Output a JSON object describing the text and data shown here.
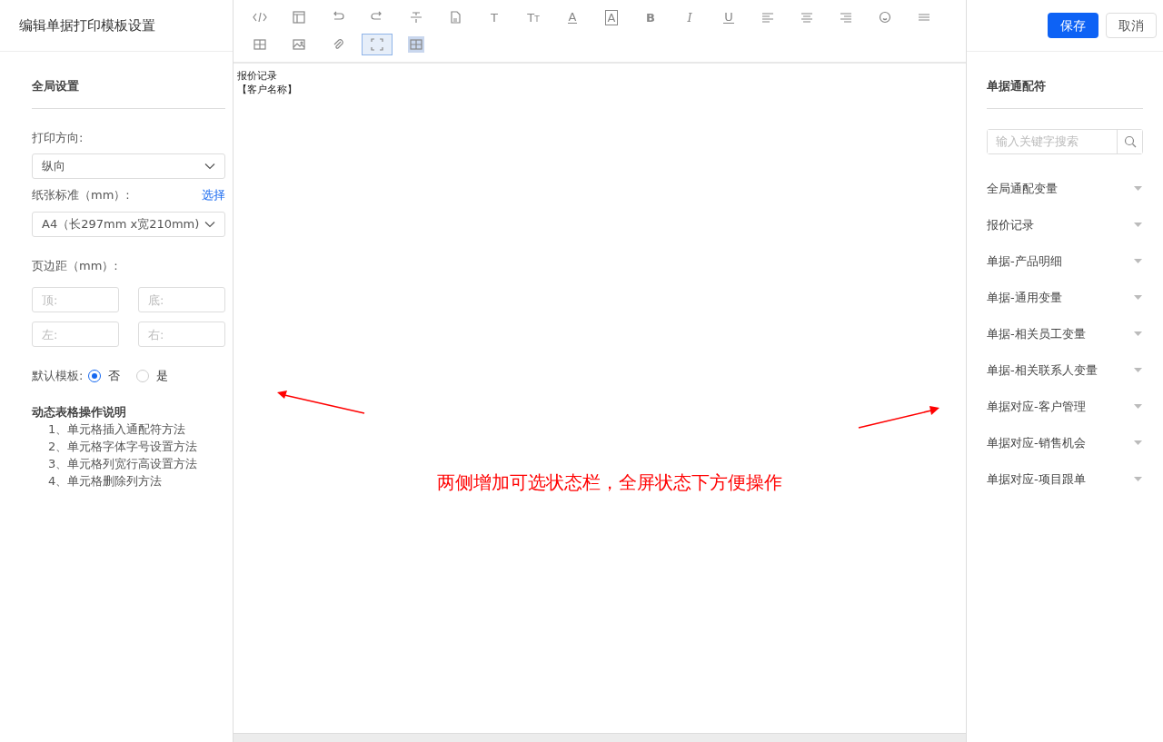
{
  "title": "编辑单据打印模板设置",
  "buttons": {
    "save": "保存",
    "cancel": "取消"
  },
  "toolbar": [
    {
      "kind": "code",
      "selected": false,
      "highlighted": false
    },
    {
      "kind": "layout",
      "selected": false,
      "highlighted": false
    },
    {
      "kind": "undo",
      "selected": false,
      "highlighted": false
    },
    {
      "kind": "redo",
      "selected": false,
      "highlighted": false
    },
    {
      "kind": "strike",
      "selected": false,
      "highlighted": false
    },
    {
      "kind": "file",
      "selected": false,
      "highlighted": false
    },
    {
      "kind": "letter",
      "glyph": "T",
      "selected": false,
      "highlighted": false
    },
    {
      "kind": "letter-small",
      "glyph": "TT",
      "selected": false,
      "highlighted": false
    },
    {
      "kind": "letter-underline",
      "glyph": "A",
      "selected": false,
      "highlighted": false
    },
    {
      "kind": "letter-boxed",
      "glyph": "A",
      "selected": false,
      "highlighted": false
    },
    {
      "kind": "letter-bold",
      "glyph": "B",
      "selected": false,
      "highlighted": false
    },
    {
      "kind": "letter-italic",
      "glyph": "I",
      "selected": false,
      "highlighted": false
    },
    {
      "kind": "letter-underline",
      "glyph": "U",
      "selected": false,
      "highlighted": false
    },
    {
      "kind": "align-left",
      "selected": false,
      "highlighted": false
    },
    {
      "kind": "align-center",
      "selected": false,
      "highlighted": false
    },
    {
      "kind": "align-right",
      "selected": false,
      "highlighted": false
    },
    {
      "kind": "emoji",
      "selected": false,
      "highlighted": false
    },
    {
      "kind": "lines",
      "selected": false,
      "highlighted": false
    },
    {
      "kind": "table",
      "selected": false,
      "highlighted": false
    },
    {
      "kind": "image",
      "selected": false,
      "highlighted": false
    },
    {
      "kind": "attach",
      "selected": false,
      "highlighted": false
    },
    {
      "kind": "fullscreen",
      "selected": true,
      "highlighted": false
    },
    {
      "kind": "table",
      "selected": false,
      "highlighted": true
    }
  ],
  "editor": {
    "lines": [
      "报价记录",
      "【客户名称】"
    ]
  },
  "annotation": {
    "text": "两侧增加可选状态栏，全屏状态下方便操作"
  },
  "left": {
    "heading": "全局设置",
    "orientation": {
      "label": "打印方向:",
      "value": "纵向"
    },
    "paper": {
      "label": "纸张标准（mm）:",
      "link": "选择",
      "value": "A4（长297mm x宽210mm)"
    },
    "margins": {
      "label": "页边距（mm）:",
      "fields": [
        {
          "placeholder": "顶:"
        },
        {
          "placeholder": "底:"
        },
        {
          "placeholder": "左:"
        },
        {
          "placeholder": "右:"
        }
      ]
    },
    "default_template": {
      "label": "默认模板:",
      "options": [
        {
          "label": "否",
          "selected": true
        },
        {
          "label": "是",
          "selected": false
        }
      ]
    },
    "help": {
      "heading": "动态表格操作说明",
      "items": [
        "1、单元格插入通配符方法",
        "2、单元格字体字号设置方法",
        "3、单元格列宽行高设置方法",
        "4、单元格删除列方法"
      ]
    }
  },
  "right": {
    "heading": "单据通配符",
    "search": {
      "placeholder": "输入关键字搜索"
    },
    "groups": [
      {
        "label": "全局通配变量",
        "expanded": false
      },
      {
        "label": "报价记录",
        "expanded": false
      },
      {
        "label": "单据-产品明细",
        "expanded": false
      },
      {
        "label": "单据-通用变量",
        "expanded": false
      },
      {
        "label": "单据-相关员工变量",
        "expanded": false
      },
      {
        "label": "单据-相关联系人变量",
        "expanded": false
      },
      {
        "label": "单据对应-客户管理",
        "expanded": false
      },
      {
        "label": "单据对应-销售机会",
        "expanded": false
      },
      {
        "label": "单据对应-项目跟单",
        "expanded": false
      }
    ]
  }
}
